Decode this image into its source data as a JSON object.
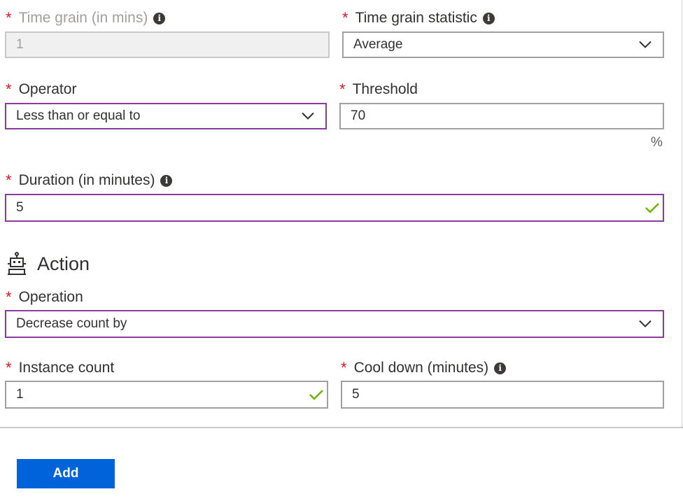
{
  "time_grain": {
    "label": "Time grain (in mins)",
    "value": "1",
    "required_mark": "*"
  },
  "time_grain_statistic": {
    "label": "Time grain statistic",
    "value": "Average",
    "required_mark": "*"
  },
  "operator": {
    "label": "Operator",
    "value": "Less than or equal to",
    "required_mark": "*"
  },
  "threshold": {
    "label": "Threshold",
    "value": "70",
    "unit": "%",
    "required_mark": "*"
  },
  "duration": {
    "label": "Duration (in minutes)",
    "value": "5",
    "required_mark": "*"
  },
  "action_section": {
    "title": "Action",
    "icon": "robot-icon"
  },
  "operation": {
    "label": "Operation",
    "value": "Decrease count by",
    "required_mark": "*"
  },
  "instance_count": {
    "label": "Instance count",
    "value": "1",
    "required_mark": "*"
  },
  "cool_down": {
    "label": "Cool down (minutes)",
    "value": "5",
    "required_mark": "*"
  },
  "info_icon_glyph": "i",
  "add_button": {
    "label": "Add"
  },
  "colors": {
    "accent_focus": "#8a3c9e",
    "required": "#e81123",
    "valid_check": "#6bb700",
    "primary_button": "#0063d9"
  }
}
